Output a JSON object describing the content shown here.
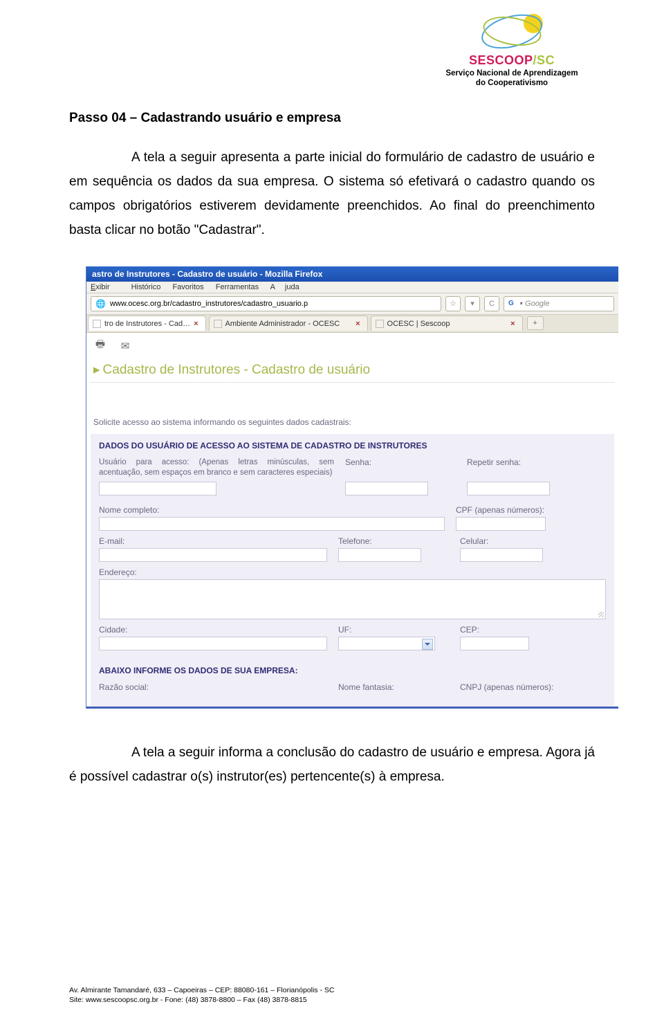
{
  "logo": {
    "title_part1": "SESCOOP",
    "title_part2": "/SC",
    "subtitle_line1": "Serviço Nacional de Aprendizagem",
    "subtitle_line2": "do Cooperativismo"
  },
  "doc": {
    "heading": "Passo 04 – Cadastrando usuário e empresa",
    "paragraph": "A tela a seguir apresenta a parte inicial do formulário de cadastro de usuário e em sequência os dados da sua empresa. O sistema só efetivará o cadastro quando os campos obrigatórios estiverem devidamente preenchidos. Ao final do preenchimento basta clicar no botão \"Cadastrar\".",
    "after_paragraph": "A tela a seguir informa a conclusão do cadastro de usuário e empresa. Agora já é possível cadastrar o(s) instrutor(es) pertencente(s) à empresa."
  },
  "browser": {
    "window_title": "astro de Instrutores - Cadastro de usuário - Mozilla Firefox",
    "menu": {
      "exibir": "Exibir",
      "historico": "Histórico",
      "favoritos": "Favoritos",
      "ferramentas": "Ferramentas",
      "ajuda": "Ajuda"
    },
    "url": "www.ocesc.org.br/cadastro_instrutores/cadastro_usuario.p",
    "search_placeholder": "Google",
    "tabs": [
      {
        "label": "tro de Instrutores - Cad…",
        "active": true
      },
      {
        "label": "Ambiente Administrador - OCESC",
        "active": false
      },
      {
        "label": "OCESC | Sescoop",
        "active": false
      }
    ]
  },
  "content": {
    "page_title": "Cadastro de Instrutores - Cadastro de usuário",
    "intro": "Solicite acesso ao sistema informando os seguintes dados cadastrais:",
    "section1_header": "DADOS DO USUÁRIO DE ACESSO AO SISTEMA DE CADASTRO DE INSTRUTORES",
    "usuario_note": "Usuário para acesso: (Apenas letras minúsculas, sem acentuação, sem espaços em branco e sem caracteres especiais)",
    "labels": {
      "senha": "Senha:",
      "repetir_senha": "Repetir senha:",
      "nome_completo": "Nome completo:",
      "cpf": "CPF (apenas números):",
      "email": "E-mail:",
      "telefone": "Telefone:",
      "celular": "Celular:",
      "endereco": "Endereço:",
      "cidade": "Cidade:",
      "uf": "UF:",
      "cep": "CEP:"
    },
    "section2_header": "ABAIXO INFORME OS DADOS DE SUA EMPRESA:",
    "labels2": {
      "razao": "Razão social:",
      "fantasia": "Nome fantasia:",
      "cnpj": "CNPJ (apenas números):"
    }
  },
  "footer": {
    "line1": "Av. Almirante Tamandaré, 633 – Capoeiras – CEP: 88080-161 – Florianópolis - SC",
    "line2": "Site: www.sescoopsc.org.br - Fone: (48) 3878-8800 – Fax (48) 3878-8815"
  }
}
